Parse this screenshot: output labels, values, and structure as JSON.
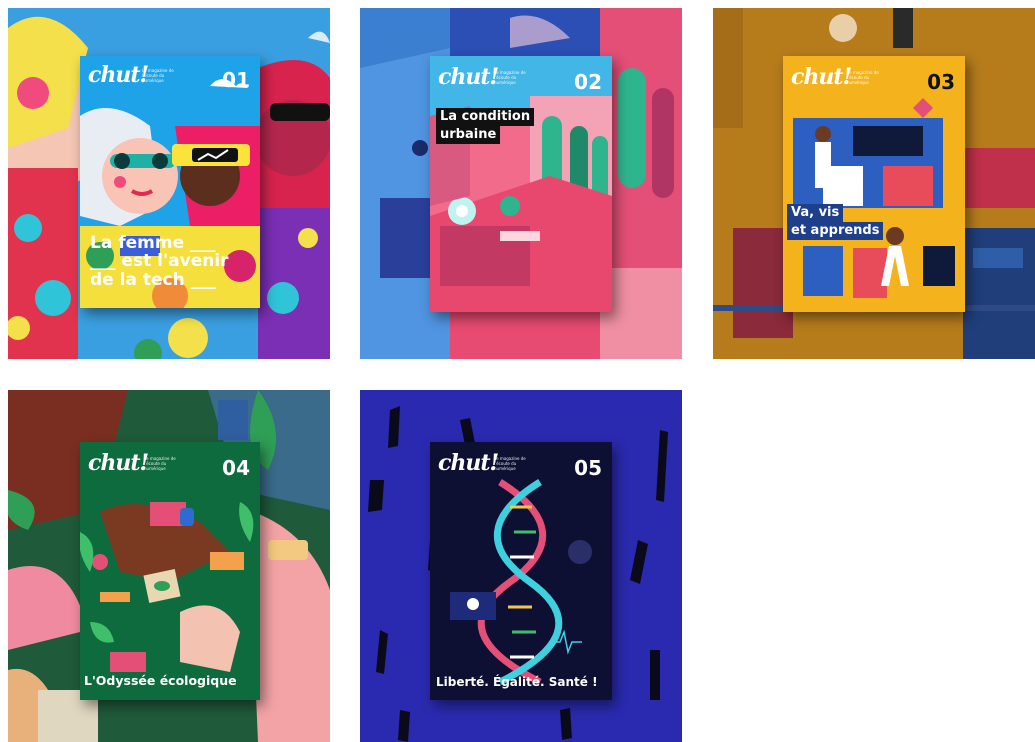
{
  "covers": [
    {
      "logo": "chut!",
      "tagline": "Le magazine de l'écoute du numérique",
      "issue": "01",
      "headline": "La femme ___ ___ est l'avenir de la tech ___",
      "headline_lines": [
        "La femme ___",
        "___ est l'avenir",
        "de la tech ___"
      ],
      "bg_color": "#3a9fe0",
      "cover_color": "#1fa3e8"
    },
    {
      "logo": "chut!",
      "tagline": "Le magazine de l'écoute du numérique",
      "issue": "02",
      "headline_lines": [
        "La condition",
        "urbaine"
      ],
      "bg_color": "#2b4fb4",
      "cover_color": "#f26b8a"
    },
    {
      "logo": "chut!",
      "tagline": "Le magazine de l'écoute du numérique",
      "issue": "03",
      "headline_lines": [
        "Va, vis",
        "et apprends"
      ],
      "bg_color": "#c98a1e",
      "cover_color": "#f4b31c"
    },
    {
      "logo": "chut!",
      "tagline": "Le magazine de l'écoute du numérique",
      "issue": "04",
      "headline_lines": [
        "L'Odyssée écologique"
      ],
      "bg_color": "#1f5a3a",
      "cover_color": "#0d6b3e"
    },
    {
      "logo": "chut!",
      "tagline": "Le magazine de l'écoute du numérique",
      "issue": "05",
      "headline_lines": [
        "Liberté. Égalité. Santé !"
      ],
      "bg_color": "#2a2ab0",
      "cover_color": "#0d1033"
    }
  ]
}
